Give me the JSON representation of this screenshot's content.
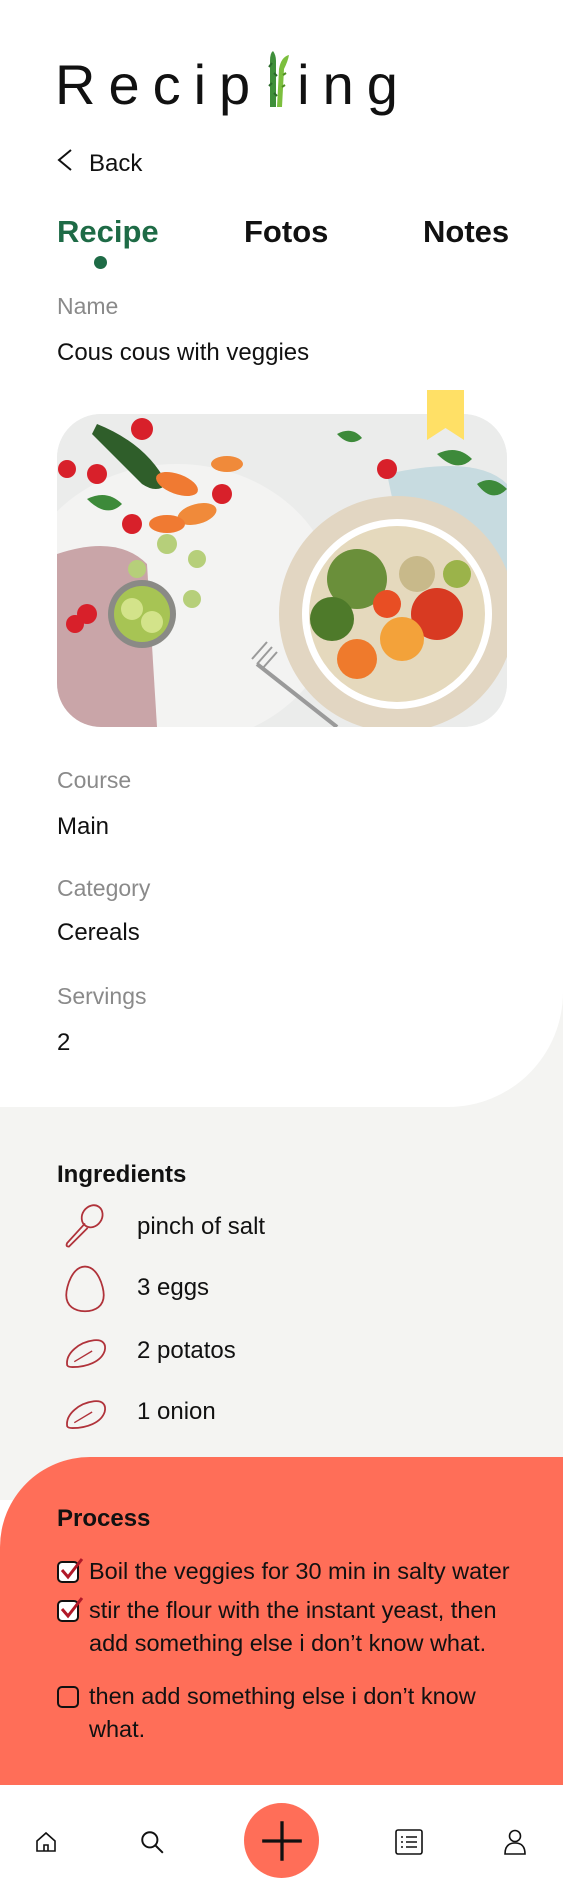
{
  "app": {
    "logo_left": "Recip",
    "logo_right": "ing"
  },
  "nav": {
    "back_label": "Back"
  },
  "tabs": [
    {
      "label": "Recipe",
      "active": true
    },
    {
      "label": "Fotos",
      "active": false
    },
    {
      "label": "Notes",
      "active": false
    }
  ],
  "recipe": {
    "name_label": "Name",
    "name": "Cous cous with veggies",
    "course_label": "Course",
    "course": "Main",
    "category_label": "Category",
    "category": "Cereals",
    "servings_label": "Servings",
    "servings": "2"
  },
  "ingredients": {
    "title": "Ingredients",
    "items": [
      {
        "icon": "spoon-icon",
        "text": "pinch of salt"
      },
      {
        "icon": "egg-icon",
        "text": "3 eggs"
      },
      {
        "icon": "potato-icon",
        "text": "2 potatos"
      },
      {
        "icon": "onion-icon",
        "text": "1 onion"
      }
    ]
  },
  "process": {
    "title": "Process",
    "steps": [
      {
        "checked": true,
        "text": "Boil the veggies for 30 min in salty water"
      },
      {
        "checked": true,
        "text": "stir the flour with the instant yeast, then add something else i don’t know what."
      },
      {
        "checked": false,
        "text": "then add something else i don’t know what."
      }
    ]
  },
  "bottom_nav": {
    "items": [
      "home-icon",
      "search-icon",
      "add-icon",
      "recipe-list-icon",
      "profile-icon"
    ]
  },
  "colors": {
    "brand_green": "#1e6b46",
    "accent_coral": "#ff6e58",
    "bookmark_yellow": "#ffe066",
    "ingredient_icon": "#b0323a",
    "panel_gray": "#f4f4f2"
  }
}
